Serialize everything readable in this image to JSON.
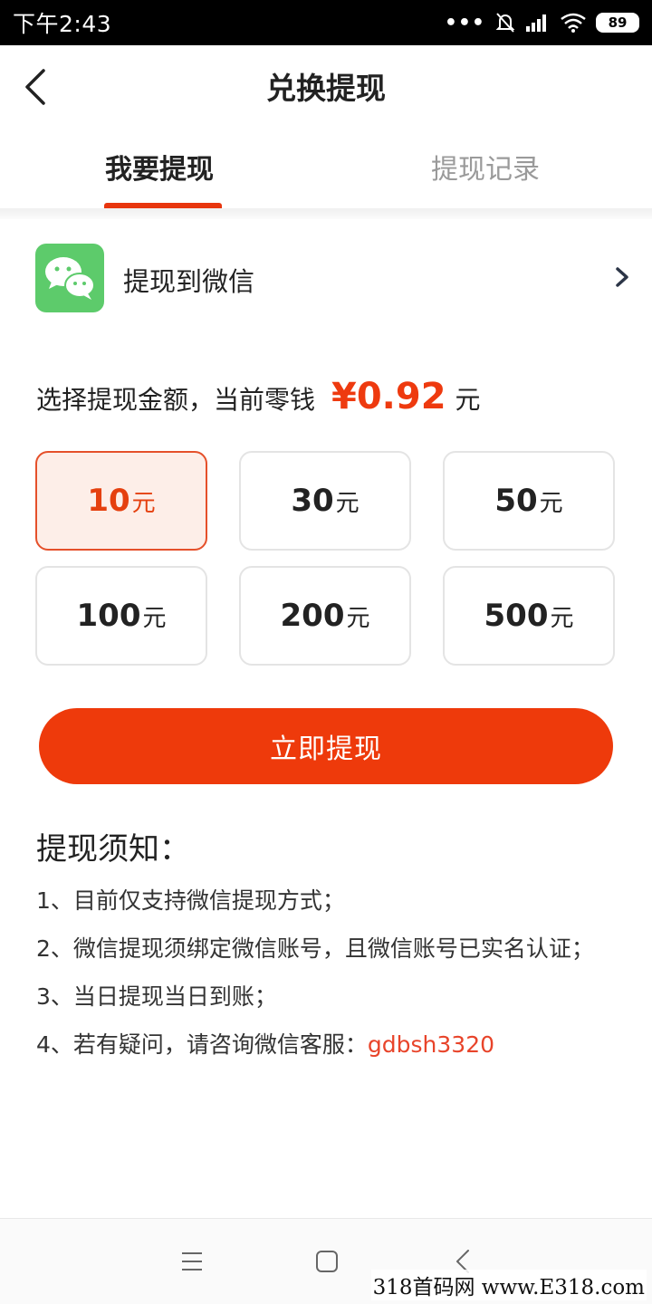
{
  "status_bar": {
    "time": "下午2:43",
    "dots": "•••",
    "battery": "89",
    "icons": [
      "mute-bell-icon",
      "signal-icon",
      "wifi-icon",
      "battery-icon"
    ]
  },
  "header": {
    "title": "兑换提现",
    "back_icon": "chevron-left-icon"
  },
  "tabs": [
    {
      "label": "我要提现",
      "active": true
    },
    {
      "label": "提现记录",
      "active": false
    }
  ],
  "wechat_row": {
    "label": "提现到微信",
    "icon": "wechat-icon",
    "chevron": "chevron-right-icon"
  },
  "amount": {
    "prompt": "选择提现金额，当前零钱",
    "value": "¥0.92",
    "unit": "元"
  },
  "options": [
    {
      "num": "10",
      "unit": "元",
      "selected": true
    },
    {
      "num": "30",
      "unit": "元",
      "selected": false
    },
    {
      "num": "50",
      "unit": "元",
      "selected": false
    },
    {
      "num": "100",
      "unit": "元",
      "selected": false
    },
    {
      "num": "200",
      "unit": "元",
      "selected": false
    },
    {
      "num": "500",
      "unit": "元",
      "selected": false
    }
  ],
  "withdraw_button": "立即提现",
  "notice": {
    "title": "提现须知：",
    "items": [
      "1、目前仅支持微信提现方式；",
      "2、微信提现须绑定微信账号，且微信账号已实名认证；",
      "3、当日提现当日到账；",
      "4、若有疑问，请咨询微信客服："
    ],
    "contact": "gdbsh3320"
  },
  "bottom_nav": {
    "items": [
      "menu-icon",
      "home-icon",
      "back-icon"
    ]
  },
  "watermark": "318首码网  www.E318.com",
  "colors": {
    "accent": "#ee3a0b",
    "selected_bg": "#fdeee8",
    "wechat_green": "#5dcb6b",
    "contact_red": "#e8442a"
  }
}
